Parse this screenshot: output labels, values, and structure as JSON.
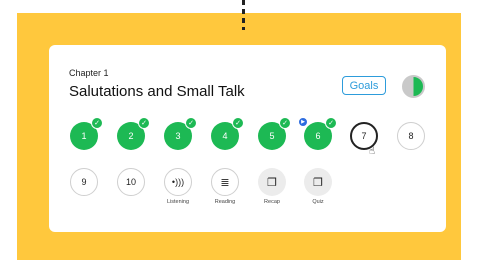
{
  "header": {
    "chapter": "Chapter 1",
    "title": "Salutations and Small Talk",
    "goals_label": "Goals"
  },
  "lessons_row1": [
    {
      "label": "1",
      "state": "completed"
    },
    {
      "label": "2",
      "state": "completed"
    },
    {
      "label": "3",
      "state": "completed"
    },
    {
      "label": "4",
      "state": "completed"
    },
    {
      "label": "5",
      "state": "completed"
    },
    {
      "label": "6",
      "state": "completed"
    },
    {
      "label": "7",
      "state": "current"
    },
    {
      "label": "8",
      "state": "locked"
    }
  ],
  "lessons_row2": [
    {
      "label": "9",
      "state": "locked"
    },
    {
      "label": "10",
      "state": "locked"
    }
  ],
  "activities": [
    {
      "icon": "listening-icon",
      "label": "Listening"
    },
    {
      "icon": "reading-icon",
      "label": "Reading"
    },
    {
      "icon": "recap-icon",
      "label": "Recap"
    },
    {
      "icon": "quiz-icon",
      "label": "Quiz"
    }
  ],
  "colors": {
    "background": "#FFC83D",
    "completed": "#1DB954",
    "accent": "#2D9CDB"
  },
  "progress_fraction": 0.5
}
